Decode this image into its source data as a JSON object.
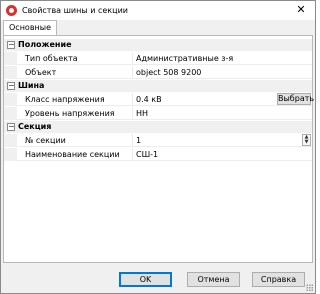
{
  "window": {
    "title": "Свойства шины и секции",
    "close_glyph": "✕"
  },
  "tabs": [
    {
      "label": "Основные"
    }
  ],
  "grid": {
    "categories": [
      {
        "label": "Положение",
        "toggle": "−",
        "rows": [
          {
            "name": "Тип объекта",
            "value": "Административные з-я"
          },
          {
            "name": "Объект",
            "value": "object 508 9200"
          }
        ]
      },
      {
        "label": "Шина",
        "toggle": "−",
        "rows": [
          {
            "name": "Класс напряжения",
            "value": "0.4 кВ",
            "button": "Выбрать"
          },
          {
            "name": "Уровень напряжения",
            "value": "НН"
          }
        ]
      },
      {
        "label": "Секция",
        "toggle": "−",
        "rows": [
          {
            "name": "№ секции",
            "value": "1",
            "spinner": {
              "up": "▲",
              "down": "▼"
            }
          },
          {
            "name": "Наименование секции",
            "value": "СШ-1"
          }
        ]
      }
    ]
  },
  "footer": {
    "ok_label": "OK",
    "cancel_label": "Отмена",
    "help_label": "Справка"
  },
  "colors": {
    "accent": "#0078d7",
    "app_icon": "#d9302c"
  }
}
